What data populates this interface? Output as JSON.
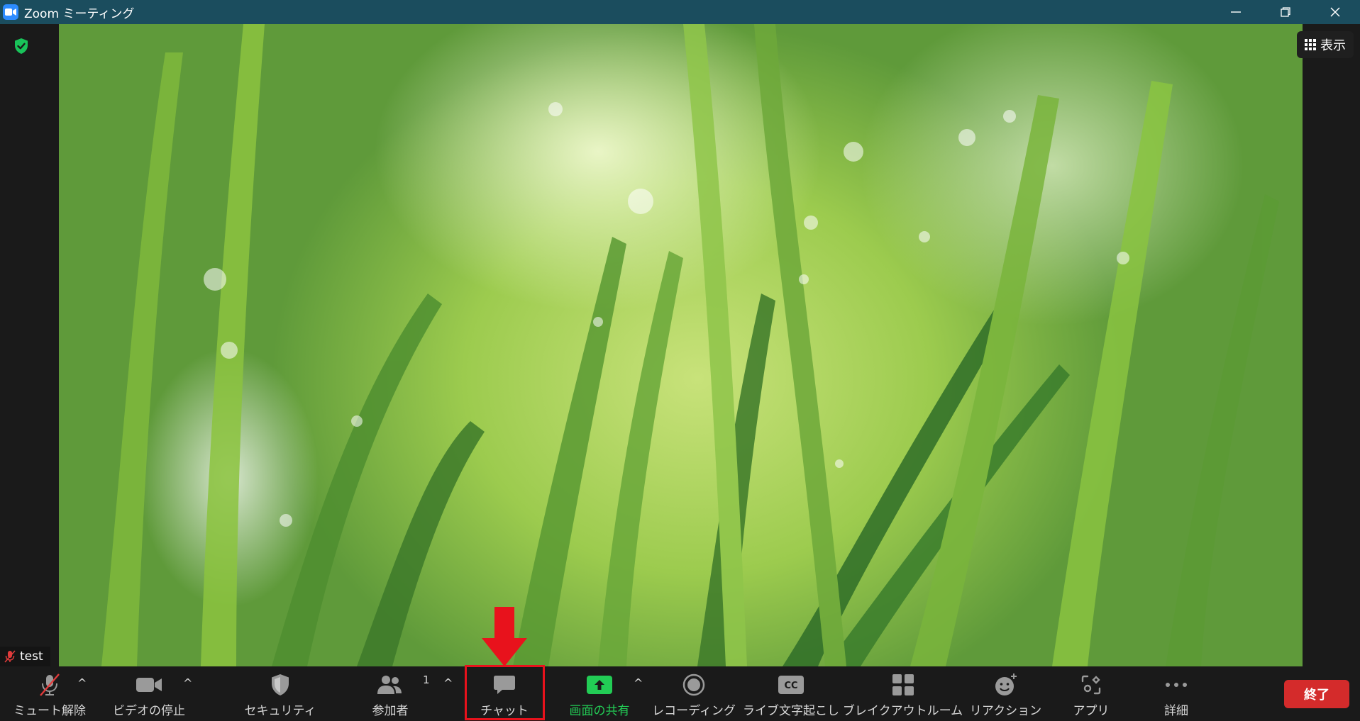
{
  "window": {
    "title": "Zoom ミーティング",
    "app_icon": "zoom-camera-icon",
    "controls": [
      "minimize-icon",
      "restore-icon",
      "close-icon"
    ]
  },
  "meeting": {
    "encryption_badge": "shield-check-icon",
    "view_button": {
      "icon": "grid-icon",
      "label": "表示"
    },
    "participant_name_tag": {
      "name": "test",
      "muted": true
    }
  },
  "toolbar": {
    "items": [
      {
        "id": "mute",
        "label": "ミュート解除",
        "icon": "microphone-muted-icon",
        "has_caret": true
      },
      {
        "id": "video",
        "label": "ビデオの停止",
        "icon": "video-camera-icon",
        "has_caret": true
      },
      {
        "id": "security",
        "label": "セキュリティ",
        "icon": "shield-icon",
        "has_caret": false
      },
      {
        "id": "participants",
        "label": "参加者",
        "icon": "people-icon",
        "count": "1",
        "has_caret": true
      },
      {
        "id": "chat",
        "label": "チャット",
        "icon": "chat-bubble-icon",
        "has_caret": false,
        "highlighted": true
      },
      {
        "id": "share",
        "label": "画面の共有",
        "icon": "share-screen-icon",
        "has_caret": true
      },
      {
        "id": "record",
        "label": "レコーディング",
        "icon": "record-icon",
        "has_caret": false
      },
      {
        "id": "captions",
        "label": "ライブ文字起こし",
        "icon": "cc-icon",
        "has_caret": false
      },
      {
        "id": "breakout",
        "label": "ブレイクアウトルーム",
        "icon": "breakout-grid-icon",
        "has_caret": false
      },
      {
        "id": "reactions",
        "label": "リアクション",
        "icon": "smiley-plus-icon",
        "has_caret": false
      },
      {
        "id": "apps",
        "label": "アプリ",
        "icon": "apps-icon",
        "has_caret": false
      },
      {
        "id": "more",
        "label": "詳細",
        "icon": "ellipsis-icon",
        "has_caret": false
      }
    ],
    "end_button": "終了"
  },
  "annotation": {
    "arrow_color": "#e8121c",
    "box_color": "#e8121c"
  },
  "colors": {
    "titlebar": "#1b4d5e",
    "share_green": "#22cc55",
    "end_red": "#d42b2b",
    "toolbar_bg": "#1a1a1a"
  }
}
